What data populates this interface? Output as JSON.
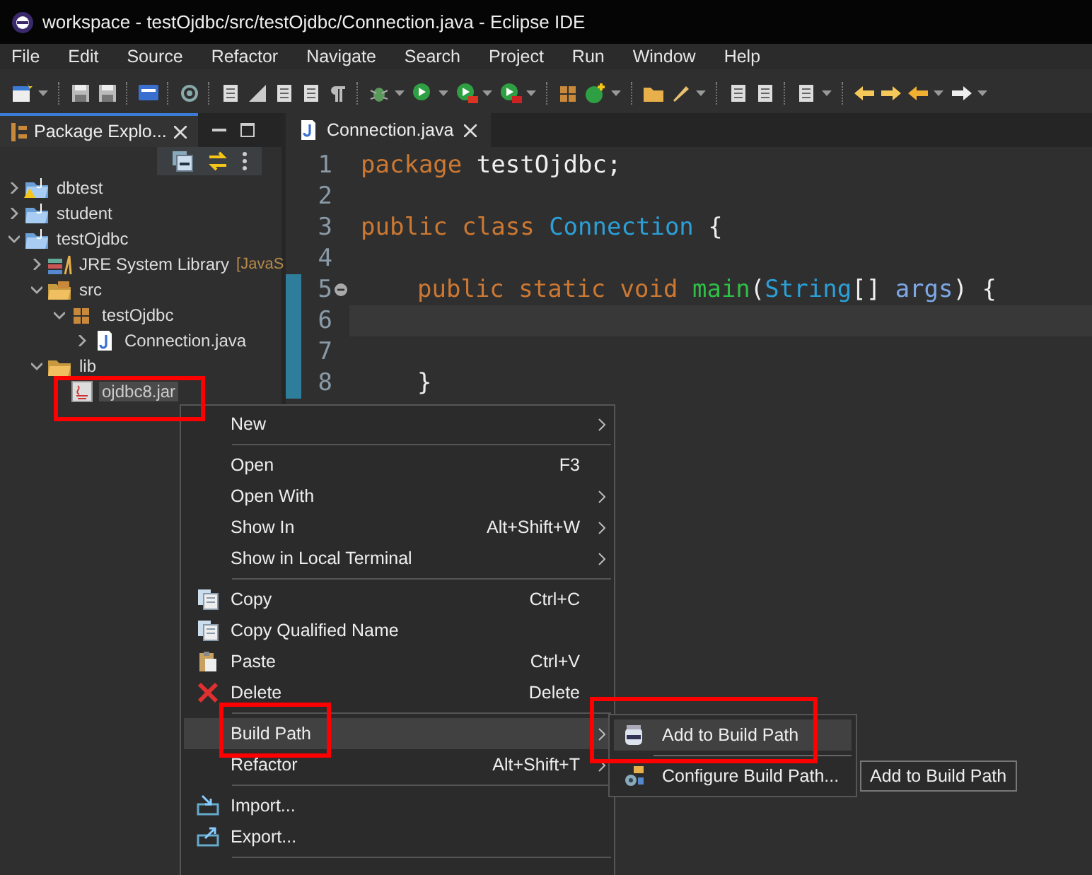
{
  "window": {
    "title": "workspace - testOjdbc/src/testOjdbc/Connection.java - Eclipse IDE"
  },
  "menu_bar": [
    "File",
    "Edit",
    "Source",
    "Refactor",
    "Navigate",
    "Search",
    "Project",
    "Run",
    "Window",
    "Help"
  ],
  "explorer": {
    "tab": "Package Explo...",
    "tree": [
      {
        "kind": "project",
        "label": "dbtest",
        "expanded": false,
        "warning": true
      },
      {
        "kind": "project",
        "label": "student",
        "expanded": false
      },
      {
        "kind": "project",
        "label": "testOjdbc",
        "expanded": true,
        "children": [
          {
            "kind": "library",
            "label": "JRE System Library",
            "decoration": "[JavaS",
            "expanded": false
          },
          {
            "kind": "source-folder",
            "label": "src",
            "expanded": true,
            "children": [
              {
                "kind": "package",
                "label": "testOjdbc",
                "expanded": true,
                "children": [
                  {
                    "kind": "java-file",
                    "label": "Connection.java",
                    "expanded": false
                  }
                ]
              }
            ]
          },
          {
            "kind": "folder",
            "label": "lib",
            "expanded": true,
            "children": [
              {
                "kind": "jar",
                "label": "ojdbc8.jar",
                "selected": true
              }
            ]
          }
        ]
      }
    ]
  },
  "editor": {
    "tab": "Connection.java",
    "lines": [
      {
        "number": "1",
        "tokens": [
          {
            "kind": "keyword",
            "text": "package"
          },
          {
            "kind": "plain",
            "text": " testOjdbc;"
          }
        ]
      },
      {
        "number": "2"
      },
      {
        "number": "3",
        "tokens": [
          {
            "kind": "keyword",
            "text": "public class"
          },
          {
            "kind": "type",
            "text": " Connection"
          },
          {
            "kind": "plain",
            "text": " {"
          }
        ]
      },
      {
        "number": "4"
      },
      {
        "number": "5",
        "changed": true,
        "foldable": true,
        "indented": true,
        "tokens": [
          {
            "kind": "keyword",
            "text": "public static void"
          },
          {
            "kind": "method",
            "text": " main"
          },
          {
            "kind": "plain",
            "text": "("
          },
          {
            "kind": "type",
            "text": "String"
          },
          {
            "kind": "plain",
            "text": "[] "
          },
          {
            "kind": "param",
            "text": "args"
          },
          {
            "kind": "plain",
            "text": ") {"
          }
        ]
      },
      {
        "number": "6",
        "current": true,
        "changed": true
      },
      {
        "number": "7",
        "changed": true
      },
      {
        "number": "8",
        "changed": true,
        "indented": true,
        "tokens": [
          {
            "kind": "plain",
            "text": "}"
          }
        ]
      }
    ]
  },
  "context_menu": {
    "items": [
      {
        "kind": "item",
        "label": "New",
        "submenu": true,
        "selected": false
      },
      {
        "kind": "separator"
      },
      {
        "kind": "item",
        "label": "Open",
        "shortcut": "F3",
        "submenu": false,
        "selected": false
      },
      {
        "kind": "item",
        "label": "Open With",
        "submenu": true,
        "selected": false
      },
      {
        "kind": "item",
        "label": "Show In",
        "shortcut": "Alt+Shift+W",
        "submenu": true,
        "selected": false
      },
      {
        "kind": "item",
        "label": "Show in Local Terminal",
        "submenu": true,
        "selected": false
      },
      {
        "kind": "separator"
      },
      {
        "kind": "item",
        "label": "Copy",
        "shortcut": "Ctrl+C",
        "submenu": false,
        "selected": false
      },
      {
        "kind": "item",
        "label": "Copy Qualified Name",
        "submenu": false,
        "selected": false
      },
      {
        "kind": "item",
        "label": "Paste",
        "shortcut": "Ctrl+V",
        "submenu": false,
        "selected": false
      },
      {
        "kind": "item",
        "label": "Delete",
        "shortcut": "Delete",
        "submenu": false,
        "selected": false
      },
      {
        "kind": "separator"
      },
      {
        "kind": "item",
        "label": "Build Path",
        "submenu": true,
        "selected": true
      },
      {
        "kind": "item",
        "label": "Refactor",
        "shortcut": "Alt+Shift+T",
        "submenu": true,
        "selected": false
      },
      {
        "kind": "separator"
      },
      {
        "kind": "item",
        "label": "Import...",
        "submenu": false,
        "selected": false
      },
      {
        "kind": "item",
        "label": "Export...",
        "submenu": false,
        "selected": false
      },
      {
        "kind": "separator"
      }
    ]
  },
  "submenu": {
    "items": [
      {
        "kind": "item",
        "label": "Add to Build Path",
        "selected": true
      },
      {
        "kind": "separator"
      },
      {
        "kind": "item",
        "label": "Configure Build Path...",
        "selected": false
      }
    ]
  },
  "tooltip": "Add to Build Path"
}
